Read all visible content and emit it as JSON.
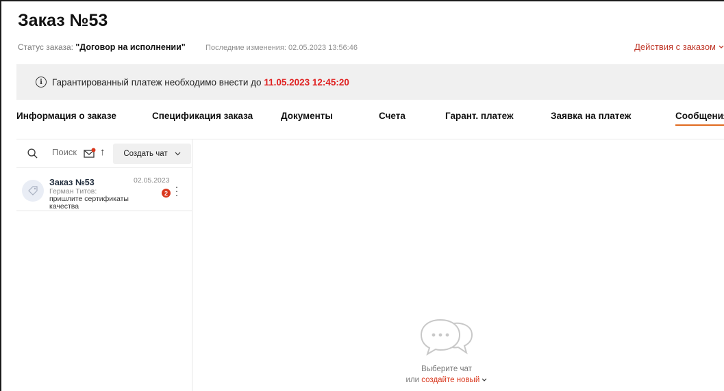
{
  "header": {
    "title": "Заказ №53",
    "status_label": "Статус заказа:",
    "status_value": "\"Договор на исполнении\"",
    "last_changes": "Последние изменения: 02.05.2023 13:56:46",
    "actions_label": "Действия с заказом"
  },
  "notice": {
    "text": "Гарантированный платеж необходимо внести до",
    "deadline": "11.05.2023 12:45:20"
  },
  "tabs": [
    {
      "label": "Информация о заказе",
      "active": false
    },
    {
      "label": "Спецификация заказа",
      "active": false
    },
    {
      "label": "Документы",
      "active": false
    },
    {
      "label": "Счета",
      "active": false
    },
    {
      "label": "Гарант. платеж",
      "active": false
    },
    {
      "label": "Заявка на платеж",
      "active": false
    },
    {
      "label": "Сообщения",
      "active": true
    }
  ],
  "sidebar": {
    "search_placeholder": "Поиск",
    "create_chat_label": "Создать чат",
    "chats": [
      {
        "title": "Заказ №53",
        "date": "02.05.2023",
        "author": "Герман Титов:",
        "message": "пришлите сертификаты качества",
        "unread": "2"
      }
    ]
  },
  "empty_state": {
    "title": "Выберите чат",
    "or_label": "или",
    "create_link": "создайте новый"
  },
  "colors": {
    "accent": "#e0691d",
    "danger": "#e02020",
    "badge": "#d9381e",
    "notice_bg": "#f0f0f0"
  }
}
